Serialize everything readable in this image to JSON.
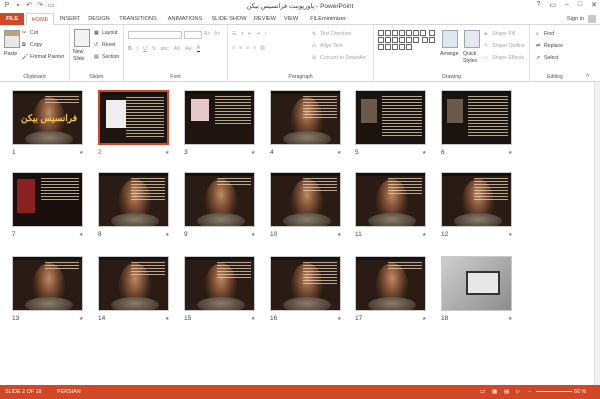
{
  "app": {
    "window_title": "پاورپوینت فرانسیس بیکن - PowerPoint"
  },
  "tabs": [
    "FILE",
    "HOME",
    "INSERT",
    "DESIGN",
    "TRANSITIONS",
    "ANIMATIONS",
    "SLIDE SHOW",
    "REVIEW",
    "VIEW",
    "FILEminimizer"
  ],
  "signin": "Sign in",
  "ribbon": {
    "clipboard": {
      "label": "Clipboard",
      "paste": "Paste",
      "cut": "Cut",
      "copy": "Copy",
      "format_painter": "Format Painter"
    },
    "slides": {
      "label": "Slides",
      "new_slide": "New",
      "new_slide2": "Slide",
      "layout": "Layout",
      "reset": "Reset",
      "section": "Section"
    },
    "font": {
      "label": "Font"
    },
    "paragraph": {
      "label": "Paragraph",
      "text_direction": "Text Direction",
      "align_text": "Align Text",
      "convert": "Convert to SmartArt"
    },
    "drawing": {
      "label": "Drawing",
      "arrange": "Arrange",
      "quick_styles": "Quick",
      "quick_styles2": "Styles",
      "shape_fill": "Shape Fill",
      "shape_outline": "Shape Outline",
      "shape_effects": "Shape Effects"
    },
    "editing": {
      "label": "Editing",
      "find": "Find",
      "replace": "Replace",
      "select": "Select"
    }
  },
  "slides": [
    {
      "n": "1",
      "kind": "title",
      "title": "فرانسیس بیکن"
    },
    {
      "n": "2",
      "kind": "portrait",
      "selected": true
    },
    {
      "n": "3",
      "kind": "portrait2"
    },
    {
      "n": "4",
      "kind": "std"
    },
    {
      "n": "5",
      "kind": "dark"
    },
    {
      "n": "6",
      "kind": "dark2"
    },
    {
      "n": "7",
      "kind": "red"
    },
    {
      "n": "8",
      "kind": "std"
    },
    {
      "n": "9",
      "kind": "std"
    },
    {
      "n": "10",
      "kind": "std"
    },
    {
      "n": "11",
      "kind": "std"
    },
    {
      "n": "12",
      "kind": "std"
    },
    {
      "n": "13",
      "kind": "std"
    },
    {
      "n": "14",
      "kind": "std"
    },
    {
      "n": "15",
      "kind": "std"
    },
    {
      "n": "16",
      "kind": "std"
    },
    {
      "n": "17",
      "kind": "std"
    },
    {
      "n": "18",
      "kind": "laptop"
    }
  ],
  "status": {
    "slide": "SLIDE 2 OF 18",
    "language": "PERSIAN",
    "zoom": "66 %"
  }
}
